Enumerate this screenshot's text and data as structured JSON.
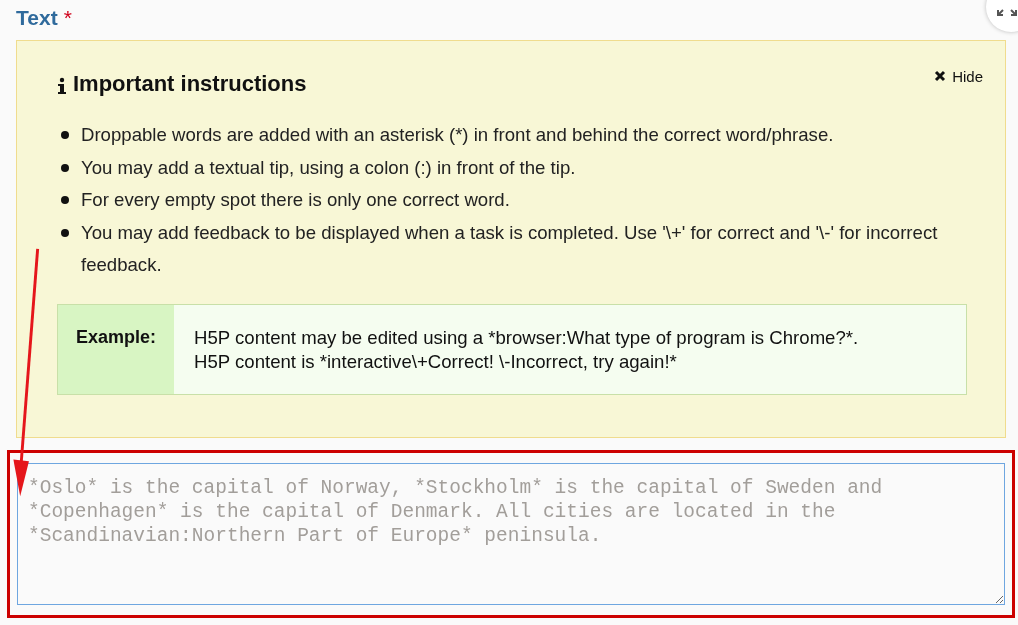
{
  "field": {
    "label": "Text",
    "required_mark": "*"
  },
  "instructions": {
    "title": "Important instructions",
    "hide_label": "Hide",
    "items": [
      "Droppable words are added with an asterisk (*) in front and behind the correct word/phrase.",
      "You may add a textual tip, using a colon (:) in front of the tip.",
      "For every empty spot there is only one correct word.",
      "You may add feedback to be displayed when a task is completed. Use '\\+' for correct and '\\-' for incorrect feedback."
    ],
    "example": {
      "label": "Example:",
      "lines": [
        "H5P content may be edited using a *browser:What type of program is Chrome?*.",
        "H5P content is *interactive\\+Correct! \\-Incorrect, try again!*"
      ]
    }
  },
  "textarea": {
    "placeholder": "*Oslo* is the capital of Norway, *Stockholm* is the capital of Sweden and *Copenhagen* is the capital of Denmark. All cities are located in the *Scandinavian:Northern Part of Europe* peninsula."
  }
}
